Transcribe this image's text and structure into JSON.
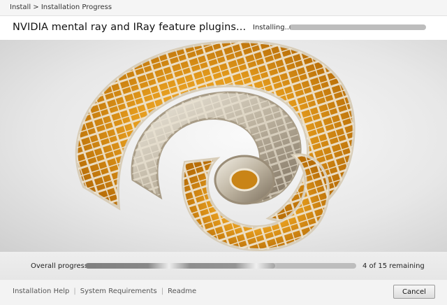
{
  "breadcrumb": {
    "text": "Install > Installation Progress"
  },
  "header": {
    "title": "NVIDIA mental ray and IRay feature plugins...",
    "status": "Installing...",
    "item_progress": 0.01
  },
  "hero": {
    "image": "orange-lattice-spiral-sculpture"
  },
  "overall": {
    "label": "Overall progress...",
    "progress": 0.7,
    "remaining": "4 of 15 remaining"
  },
  "footer": {
    "links": [
      "Installation Help",
      "System Requirements",
      "Readme"
    ],
    "cancel_label": "Cancel"
  },
  "colors": {
    "accent": "#e8a01c",
    "bar_track": "#bdbdbd",
    "bar_fill": "#8a8a8a"
  }
}
